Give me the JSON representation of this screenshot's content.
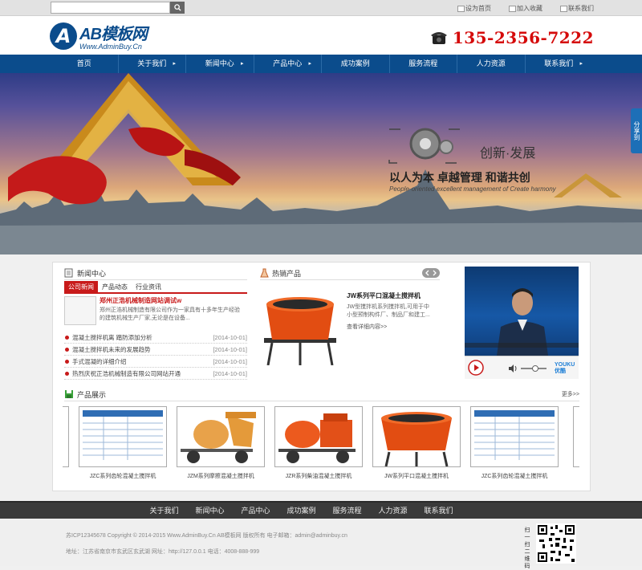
{
  "topbar": {
    "search_placeholder": "",
    "links": [
      "设为首页",
      "加入收藏",
      "联系我们"
    ]
  },
  "header": {
    "logo_letter": "A",
    "logo_name": "AB模板网",
    "logo_sub": "Www.AdminBuy.Cn",
    "phone": "135-2356-7222"
  },
  "nav": {
    "items": [
      {
        "label": "首页",
        "arrow": ""
      },
      {
        "label": "关于我们",
        "arrow": "▸"
      },
      {
        "label": "新闻中心",
        "arrow": "▸"
      },
      {
        "label": "产品中心",
        "arrow": "▸"
      },
      {
        "label": "成功案例",
        "arrow": ""
      },
      {
        "label": "服务流程",
        "arrow": ""
      },
      {
        "label": "人力资源",
        "arrow": ""
      },
      {
        "label": "联系我们",
        "arrow": "▸"
      }
    ]
  },
  "banner": {
    "share": "分享到",
    "slogan1": "创新·发展",
    "slogan2": "以人为本 卓越管理 和谐共创",
    "slogan3": "People-oriented excellent management of  Create harmony"
  },
  "news": {
    "title": "新闻中心",
    "tabs": [
      "公司新闻",
      "产品动态",
      "行业资讯"
    ],
    "feature_title": "郑州正浩机械制造网站调试w",
    "feature_desc": "郑州正浩机械制造有限公司作为一家具有十多年生产经验的建筑机械生产厂家,无论是在设备...",
    "items": [
      {
        "title": "混凝土搅拌机离 踏防添加分析",
        "date": "[2014-10-01]"
      },
      {
        "title": "混凝土搅拌机未来的发展趋势",
        "date": "[2014-10-01]"
      },
      {
        "title": "手式混凝的详细介绍",
        "date": "[2014-10-01]"
      },
      {
        "title": "热烈庆祝正浩机械制造有限公司网站开通",
        "date": "[2014-10-01]"
      }
    ]
  },
  "hot": {
    "title": "热销产品",
    "product_title": "JW系列平口混凝土搅拌机",
    "product_desc": "JW型搅拌机系列搅拌机,可用于中小型预制构件厂、制品厂和建工...",
    "more": "查看详细内容>>"
  },
  "video": {
    "brand": "YOUKU 优酷"
  },
  "products": {
    "title": "产品展示",
    "more": "更多>>",
    "items": [
      {
        "caption": "JZC系列齿轮混凝土搅拌机"
      },
      {
        "caption": "JZM系列摩擦混凝土搅拌机"
      },
      {
        "caption": "JZR系列柴油混凝土搅拌机"
      },
      {
        "caption": "JW系列平口混凝土搅拌机"
      },
      {
        "caption": "JZC系列齿轮混凝土搅拌机"
      }
    ]
  },
  "footer": {
    "nav": [
      "关于我们",
      "新闻中心",
      "产品中心",
      "成功案例",
      "服务流程",
      "人力资源",
      "联系我们"
    ],
    "line1": "苏ICP12345678   Copyright © 2014-2015 Www.AdminBuy.Cn AB模板网 版权所有   电子邮箱：admin@adminbuy.cn",
    "line2": "地址：江苏省南京市玄武区玄武湖     网址：http://127.0.0.1     电话：4008-888-999",
    "qr_label": "扫一扫二维码"
  },
  "colors": {
    "brand_blue": "#0b4c8c",
    "accent_red": "#c81a1a",
    "phone_red": "#d50a0a"
  }
}
